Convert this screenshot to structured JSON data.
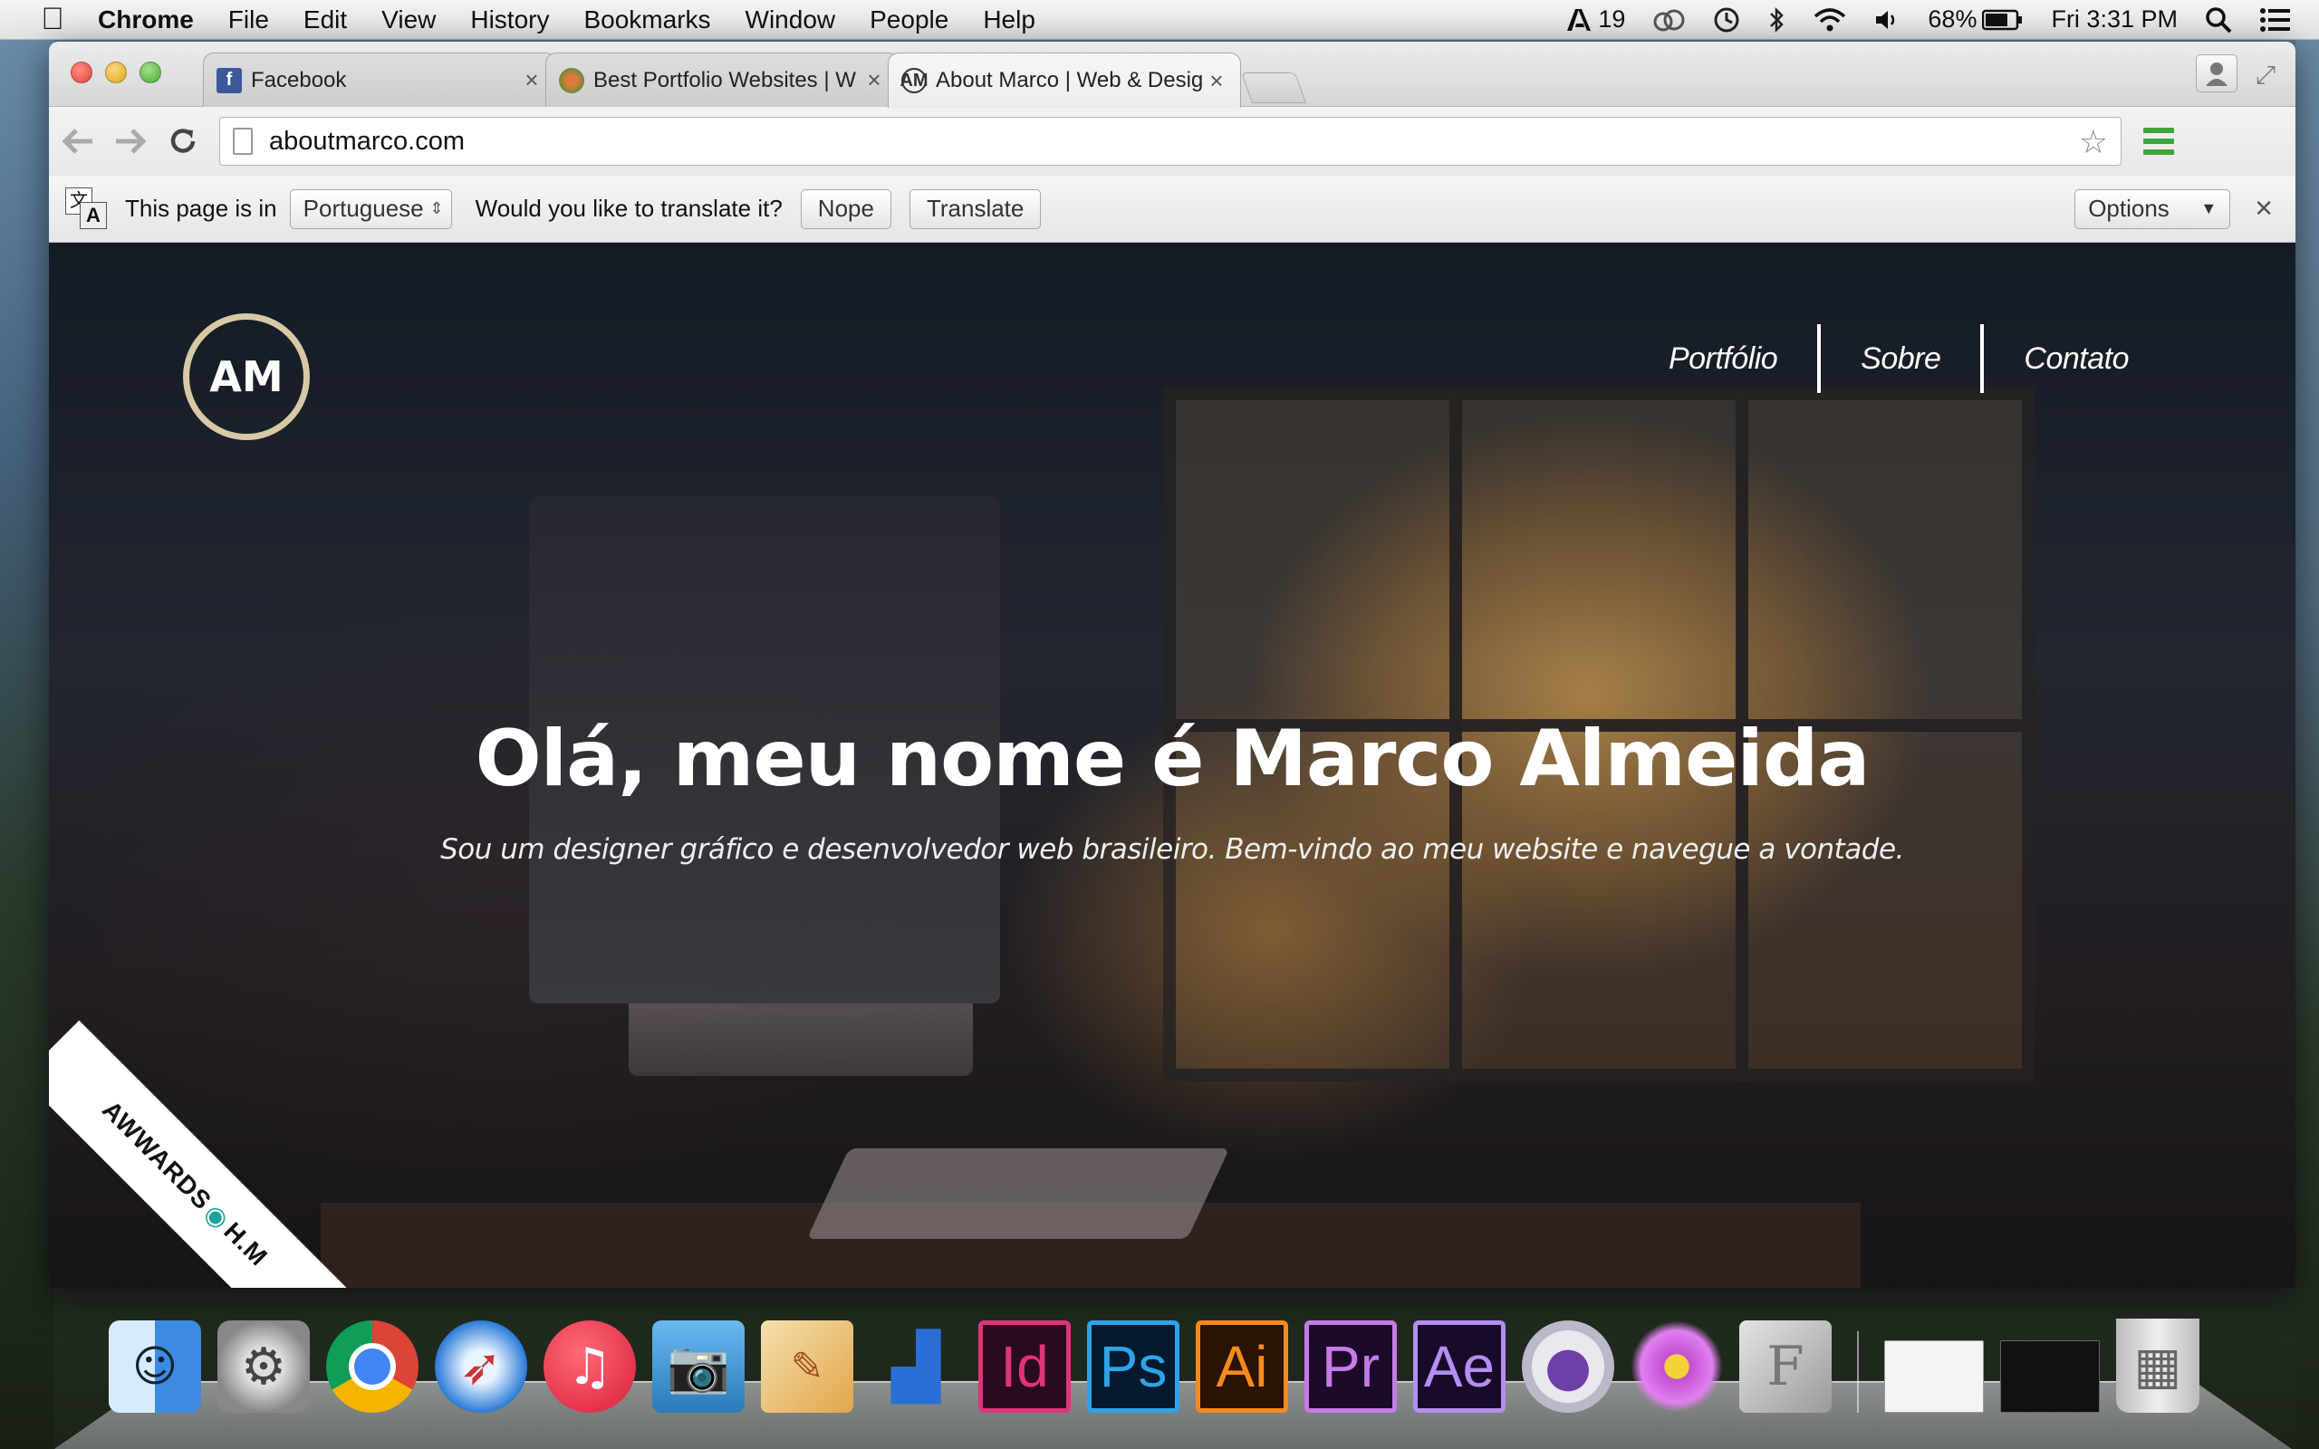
{
  "menubar": {
    "app_name": "Chrome",
    "items": [
      "File",
      "Edit",
      "View",
      "History",
      "Bookmarks",
      "Window",
      "People",
      "Help"
    ],
    "status": {
      "adobe_count": "19",
      "battery": "68%",
      "clock": "Fri 3:31 PM"
    }
  },
  "browser": {
    "tabs": [
      {
        "title": "Facebook",
        "favicon": "facebook-icon"
      },
      {
        "title": "Best Portfolio Websites | W",
        "favicon": "awwwards-icon"
      },
      {
        "title": "About Marco | Web & Desig",
        "favicon": "am-logo-icon",
        "active": true
      }
    ],
    "url": "aboutmarco.com",
    "translate_bar": {
      "prefix": "This page is in",
      "language": "Portuguese",
      "question": "Would you like to translate it?",
      "nope": "Nope",
      "translate": "Translate",
      "options": "Options"
    }
  },
  "site": {
    "logo": "AM",
    "nav": [
      "Portfólio",
      "Sobre",
      "Contato"
    ],
    "headline": "Olá, meu nome é Marco Almeida",
    "subheadline": "Sou um designer gráfico e desenvolvedor web brasileiro. Bem-vindo ao meu website e navegue a vontade.",
    "ribbon": {
      "left": "AWWARDS",
      "right": "H.M"
    }
  },
  "dock": {
    "adobe_apps": [
      "Id",
      "Ps",
      "Ai",
      "Pr",
      "Ae"
    ]
  },
  "colors": {
    "accent_green": "#3fa53a",
    "logo_ring": "#d8c9a6",
    "facebook_blue": "#3b5998"
  }
}
